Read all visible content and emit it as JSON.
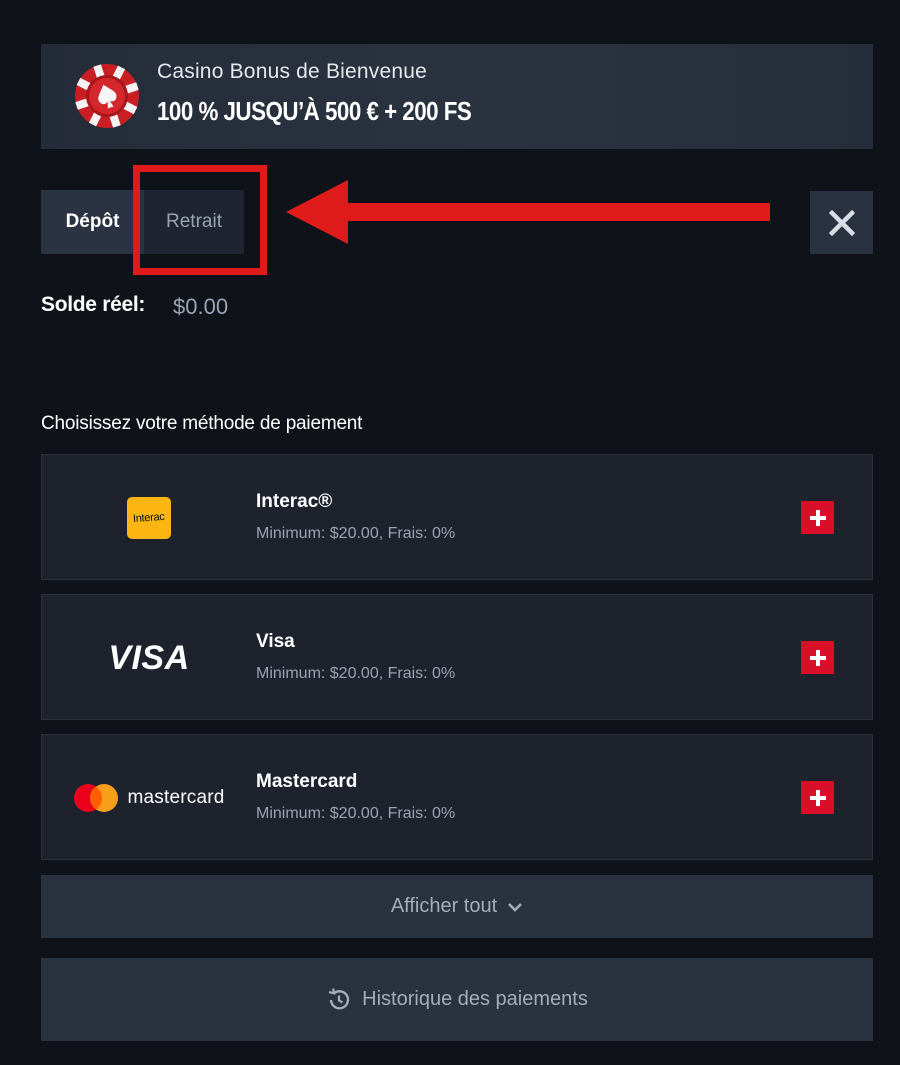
{
  "banner": {
    "subtitle": "Casino Bonus de Bienvenue",
    "title": "100 % JUSQU’À 500 € + 200 FS",
    "chip_icon": "casino-chip-icon"
  },
  "tabs": [
    {
      "label": "Dépôt",
      "active": true
    },
    {
      "label": "Retrait",
      "active": false
    }
  ],
  "close_icon": "close-icon",
  "balance": {
    "label": "Solde réel:",
    "value": "$0.00"
  },
  "section_title": "Choisissez votre méthode de paiement",
  "payment_methods": [
    {
      "name": "Interac®",
      "meta": "Minimum: $20.00, Frais: 0%",
      "logo_text": "Interac"
    },
    {
      "name": "Visa",
      "meta": "Minimum: $20.00, Frais: 0%",
      "logo_text": "VISA"
    },
    {
      "name": "Mastercard",
      "meta": "Minimum: $20.00, Frais: 0%",
      "logo_text": "mastercard"
    }
  ],
  "show_all": {
    "label": "Afficher tout",
    "icon": "chevron-down-icon"
  },
  "history": {
    "label": "Historique des paiements",
    "icon": "history-icon"
  },
  "colors": {
    "background": "#0f1218",
    "card": "#1d222d",
    "button": "#2a313f",
    "accent_red": "#d90f2a",
    "highlight_red": "#e01b1b",
    "muted_text": "#9aa3b2"
  }
}
